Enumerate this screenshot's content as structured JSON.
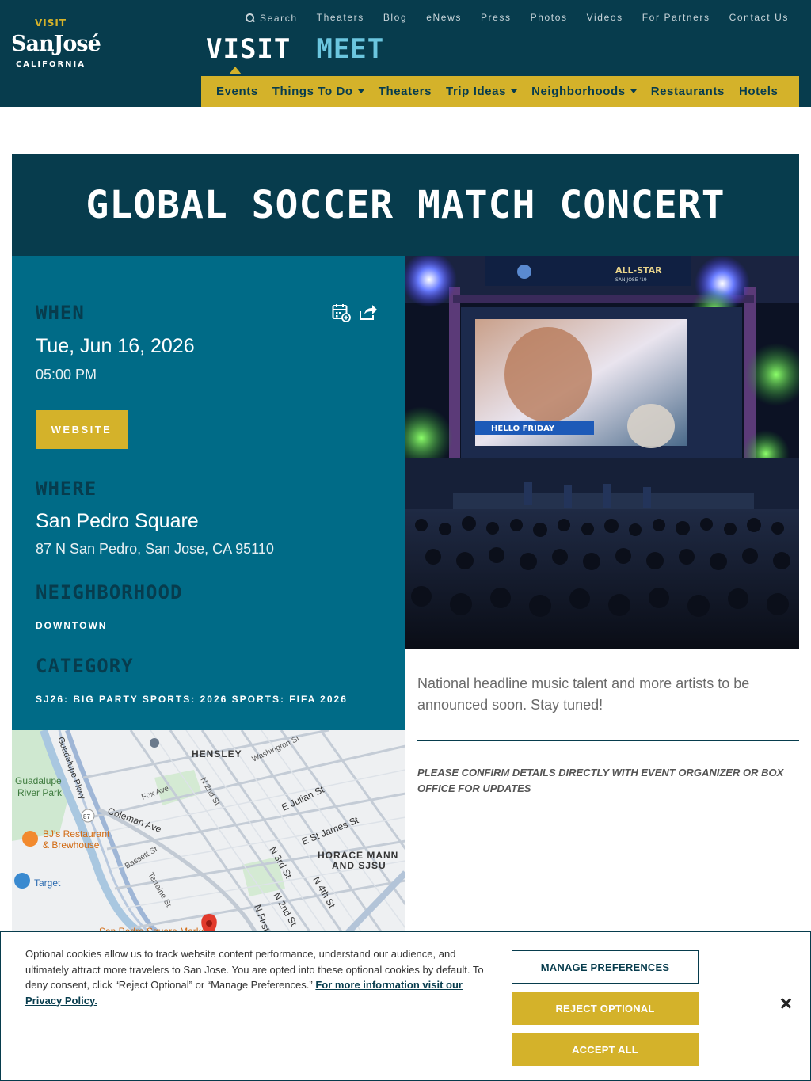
{
  "header": {
    "logo": {
      "top": "VISIT",
      "main": "SanJosé",
      "bottom": "CALIFORNIA"
    },
    "utility_links": [
      "Search",
      "Theaters",
      "Blog",
      "eNews",
      "Press",
      "Photos",
      "Videos",
      "For Partners",
      "Contact Us"
    ],
    "big_tabs": [
      "VISIT",
      "MEET"
    ],
    "nav": [
      {
        "label": "Events",
        "dropdown": false
      },
      {
        "label": "Things To Do",
        "dropdown": true
      },
      {
        "label": "Theaters",
        "dropdown": false
      },
      {
        "label": "Trip Ideas",
        "dropdown": true
      },
      {
        "label": "Neighborhoods",
        "dropdown": true
      },
      {
        "label": "Restaurants",
        "dropdown": false
      },
      {
        "label": "Hotels",
        "dropdown": false
      }
    ]
  },
  "event": {
    "title": "GLOBAL SOCCER MATCH CONCERT",
    "when_label": "WHEN",
    "date": "Tue, Jun 16, 2026",
    "time": "05:00 PM",
    "website_label": "WEBSITE",
    "where_label": "WHERE",
    "venue": "San Pedro Square",
    "address": "87 N San Pedro, San Jose, CA 95110",
    "neighborhood_label": "NEIGHBORHOOD",
    "neighborhood": "DOWNTOWN",
    "category_label": "CATEGORY",
    "category": "SJ26: BIG PARTY SPORTS: 2026 SPORTS: FIFA 2026",
    "description": "National headline music talent and more artists to be announced soon. Stay tuned!",
    "disclaimer": "PLEASE CONFIRM DETAILS DIRECTLY WITH EVENT ORGANIZER OR BOX OFFICE FOR UPDATES"
  },
  "hero": {
    "screen_banner": "ALL-STAR",
    "screen_sub": "SAN JOSE '19",
    "screen_caption": "HELLO FRIDAY"
  },
  "map": {
    "labels": {
      "hensley": "HENSLEY",
      "washington": "Washington St",
      "guadalupe_pkwy": "Guadalupe Pkwy",
      "guadalupe_park_1": "Guadalupe",
      "guadalupe_park_2": "River Park",
      "fox": "Fox Ave",
      "n2nd_top": "N 2nd St",
      "julian": "E Julian St",
      "coleman": "Coleman Ave",
      "james": "E St James St",
      "route": "87",
      "bjs_1": "BJ's Restaurant",
      "bjs_2": "& Brewhouse",
      "bassett": "Bassett St",
      "n3rd": "N 3rd St",
      "horace_1": "HORACE MANN",
      "horace_2": "AND SJSU",
      "target": "Target",
      "terraine": "Terraine St",
      "n2nd_bottom": "N 2nd St",
      "n4th": "N 4th St",
      "nfirst": "N First",
      "market": "San Pedro Square Market"
    }
  },
  "cookie": {
    "text": "Optional cookies allow us to track website content performance, understand our audience, and ultimately attract more travelers to San Jose. You are opted into these optional cookies by default. To deny consent, click “Reject Optional” or “Manage Preferences.” ",
    "link": "For more information visit our Privacy Policy.",
    "manage": "MANAGE PREFERENCES",
    "reject": "REJECT OPTIONAL",
    "accept": "ACCEPT ALL"
  },
  "colors": {
    "navy": "#073c4d",
    "teal": "#006b87",
    "gold": "#d4b22a",
    "light_blue": "#6bc6df"
  }
}
